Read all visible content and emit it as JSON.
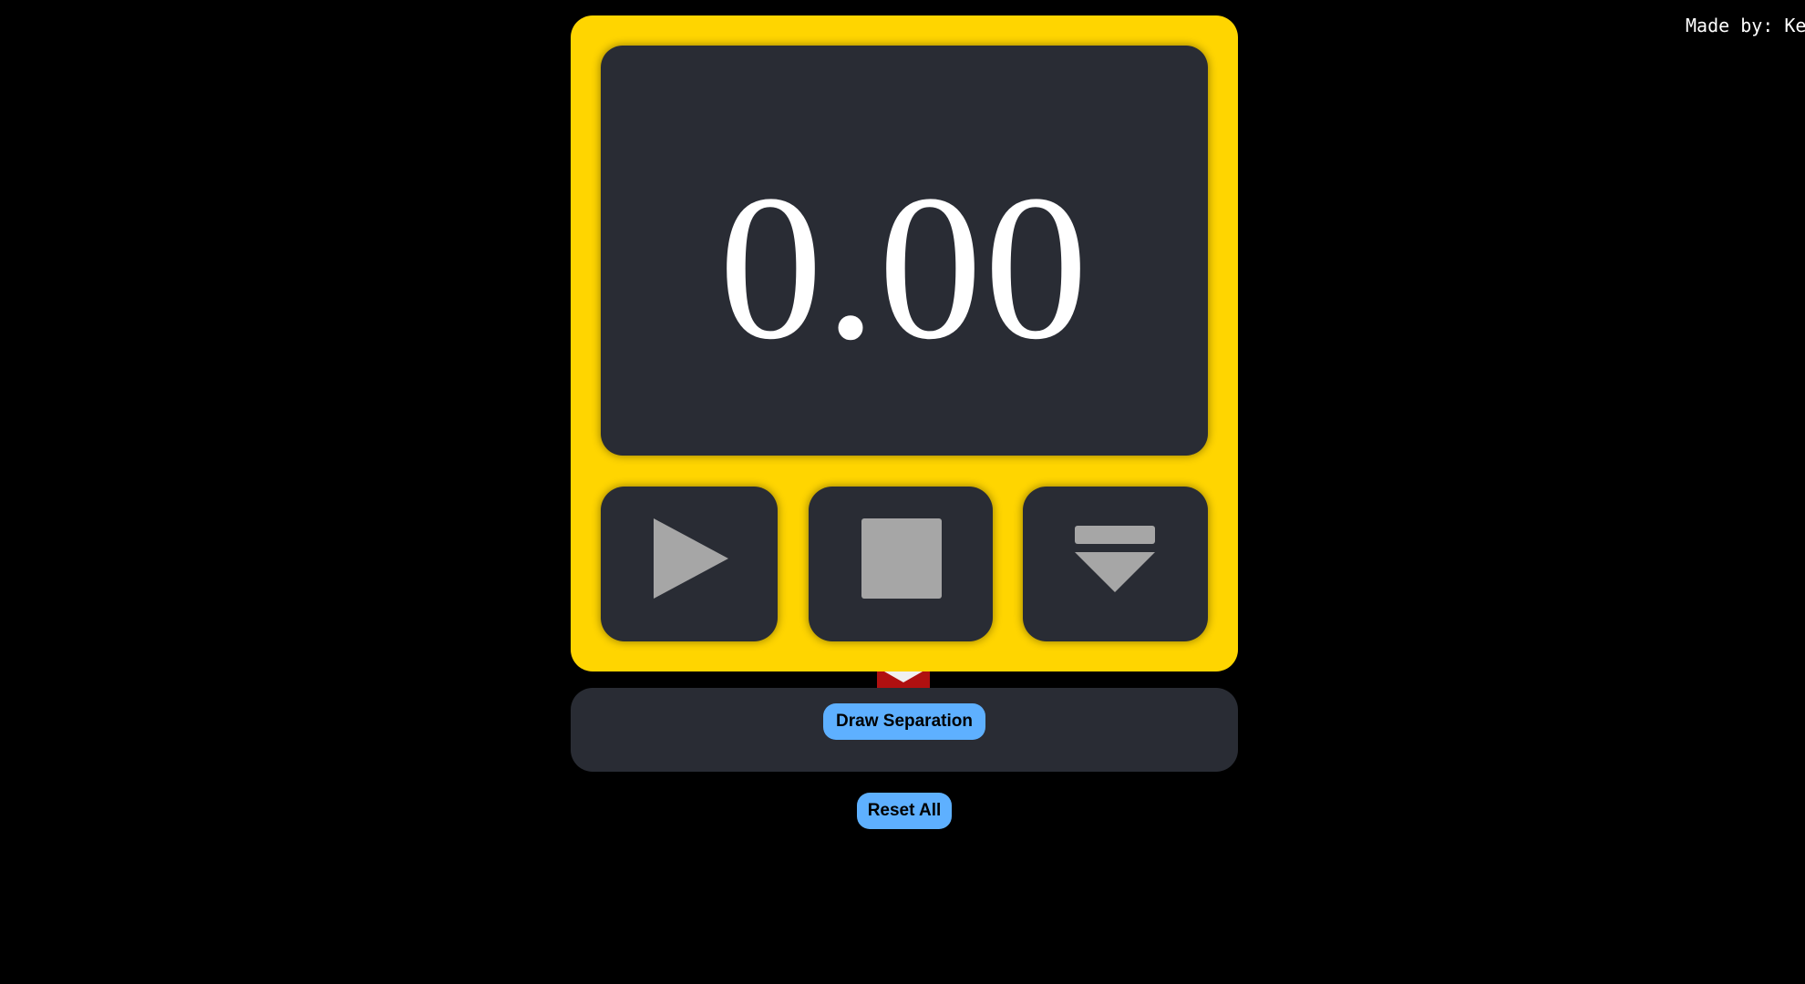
{
  "credit": "Made by: Kev",
  "timer": {
    "display": "0.00"
  },
  "controls": {
    "start_icon": "play-icon",
    "stop_icon": "stop-icon",
    "lap_icon": "lap-marker-icon"
  },
  "separation": {
    "draw_label": "Draw Separation"
  },
  "reset_label": "Reset All",
  "colors": {
    "background": "#000000",
    "body": "#ffd500",
    "panel": "#292c34",
    "icon": "#a6a6a6",
    "button_accent": "#5eb0ff",
    "tab": "#b01010"
  }
}
